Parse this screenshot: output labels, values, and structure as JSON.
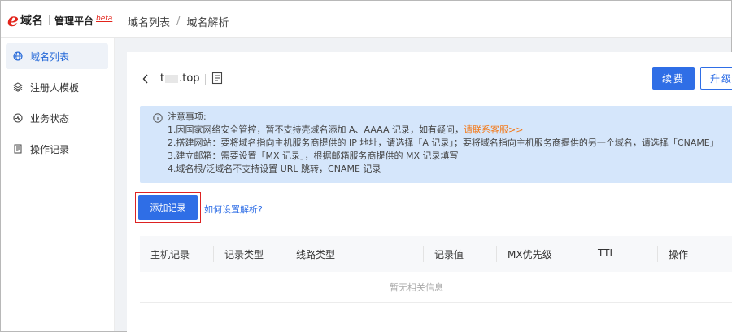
{
  "header": {
    "logo_mark": "e",
    "brand": "域名",
    "platform": "管理平台",
    "beta": "beta",
    "breadcrumb": [
      "域名列表",
      "域名解析"
    ],
    "breadcrumb_sep": "/"
  },
  "sidebar": {
    "items": [
      {
        "label": "域名列表",
        "icon": "globe-icon",
        "active": true
      },
      {
        "label": "注册人模板",
        "icon": "layers-icon",
        "active": false
      },
      {
        "label": "业务状态",
        "icon": "status-icon",
        "active": false
      },
      {
        "label": "操作记录",
        "icon": "log-icon",
        "active": false
      }
    ]
  },
  "domain": {
    "prefix": "t",
    "suffix": ".top"
  },
  "actions": {
    "renew": "续费",
    "upgrade": "升级"
  },
  "notice": {
    "title": "注意事项:",
    "line1": "1.因国家网络安全管控，暂不支持壳域名添加 A、AAAA 记录，如有疑问，",
    "line1_link": "请联系客服>>",
    "line2": "2.搭建网站：要将域名指向主机服务商提供的 IP 地址，请选择「A 记录」；要将域名指向主机服务商提供的另一个域名，请选择「CNAME」",
    "line3": "3.建立邮箱：需要设置「MX 记录」，根据邮箱服务商提供的 MX 记录填写",
    "line4": "4.域名根/泛域名不支持设置 URL 跳转，CNAME 记录"
  },
  "records": {
    "add_button": "添加记录",
    "help_link": "如何设置解析?",
    "columns": [
      "主机记录",
      "记录类型",
      "线路类型",
      "记录值",
      "MX优先级",
      "TTL",
      "操作"
    ],
    "empty_text": "暂无相关信息"
  },
  "colors": {
    "accent": "#2f6ee6",
    "brand_red": "#e2231a",
    "notice_bg": "#d5e6fb",
    "link_orange": "#f37b1d"
  }
}
